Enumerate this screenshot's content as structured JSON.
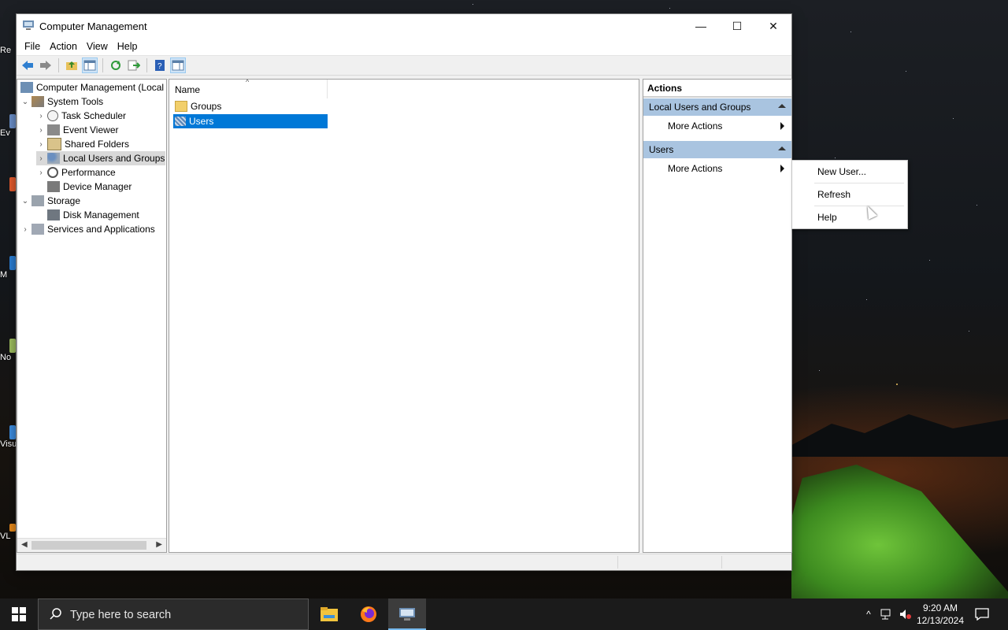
{
  "window": {
    "title": "Computer Management",
    "menu": [
      "File",
      "Action",
      "View",
      "Help"
    ],
    "controls": {
      "minimize": "—",
      "maximize": "☐",
      "close": "✕"
    }
  },
  "tree": {
    "items": [
      {
        "label": "Computer Management (Local",
        "expander": "",
        "icon": "computer-management-icon"
      },
      {
        "label": "System Tools",
        "expander": "⌄",
        "icon": "tools-icon"
      },
      {
        "label": "Task Scheduler",
        "expander": "›",
        "icon": "clock-icon"
      },
      {
        "label": "Event Viewer",
        "expander": "›",
        "icon": "event-viewer-icon"
      },
      {
        "label": "Shared Folders",
        "expander": "›",
        "icon": "shared-folder-icon"
      },
      {
        "label": "Local Users and Groups",
        "expander": "›",
        "icon": "users-icon"
      },
      {
        "label": "Performance",
        "expander": "›",
        "icon": "performance-icon"
      },
      {
        "label": "Device Manager",
        "expander": "",
        "icon": "device-manager-icon"
      },
      {
        "label": "Storage",
        "expander": "⌄",
        "icon": "storage-icon"
      },
      {
        "label": "Disk Management",
        "expander": "",
        "icon": "disk-icon"
      },
      {
        "label": "Services and Applications",
        "expander": "›",
        "icon": "services-icon"
      }
    ]
  },
  "list": {
    "column": "Name",
    "rows": [
      {
        "label": "Groups",
        "icon": "folder-icon"
      },
      {
        "label": "Users",
        "icon": "users-folder-icon"
      }
    ]
  },
  "actions": {
    "header": "Actions",
    "section1": "Local Users and Groups",
    "section1_item": "More Actions",
    "section2": "Users",
    "section2_item": "More Actions"
  },
  "context_menu": {
    "items": [
      "New User...",
      "Refresh",
      "Help"
    ]
  },
  "taskbar": {
    "search_placeholder": "Type here to search",
    "time": "9:20 AM",
    "date": "12/13/2024"
  },
  "desktop_icons": [
    "Re",
    "Ev",
    "M",
    "No",
    "Visu",
    "VL"
  ]
}
